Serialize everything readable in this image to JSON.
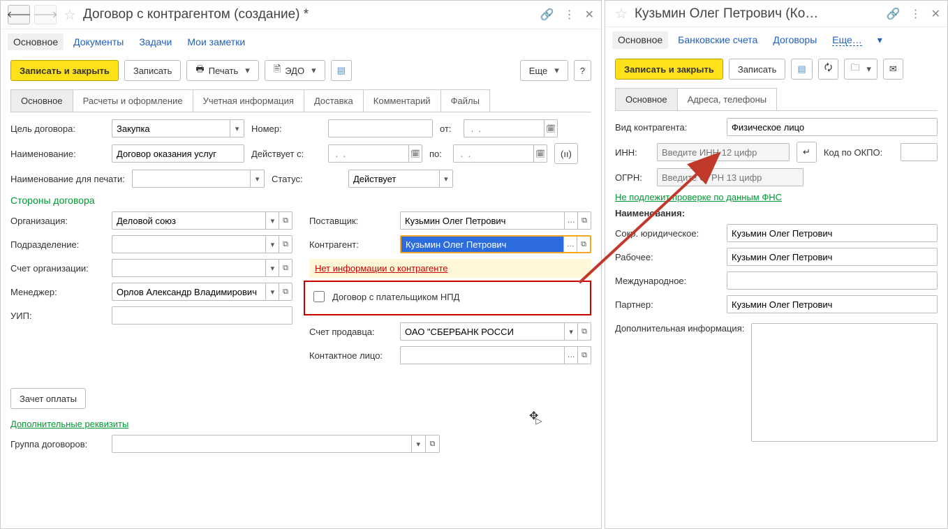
{
  "left": {
    "title": "Договор с контрагентом (создание) *",
    "nav": [
      "Основное",
      "Документы",
      "Задачи",
      "Мои заметки"
    ],
    "toolbar": {
      "save_close": "Записать и закрыть",
      "save": "Записать",
      "print": "Печать",
      "edo": "ЭДО",
      "more": "Еще"
    },
    "tabs": [
      "Основное",
      "Расчеты и оформление",
      "Учетная информация",
      "Доставка",
      "Комментарий",
      "Файлы"
    ],
    "labels": {
      "purpose": "Цель договора:",
      "number": "Номер:",
      "from": "от:",
      "name": "Наименование:",
      "valid_from": "Действует с:",
      "to": "по:",
      "print_name": "Наименование для печати:",
      "status": "Статус:",
      "parties": "Стороны договора",
      "org": "Организация:",
      "supplier": "Поставщик:",
      "dept": "Подразделение:",
      "counterparty": "Контрагент:",
      "org_acct": "Счет организации:",
      "manager": "Менеджер:",
      "seller_acct": "Счет продавца:",
      "uip": "УИП:",
      "contact": "Контактное лицо:",
      "offset": "Зачет оплаты",
      "add_req": "Дополнительные реквизиты",
      "group": "Группа договоров:",
      "no_info": "Нет информации о контрагенте",
      "npd_check": "Договор с плательщиком НПД"
    },
    "values": {
      "purpose": "Закупка",
      "name": "Договор оказания услуг",
      "status": "Действует",
      "org": "Деловой союз",
      "supplier": "Кузьмин Олег Петрович",
      "counterparty": "Кузьмин Олег Петрович",
      "manager": "Орлов Александр Владимирович",
      "seller_acct": "ОАО \"СБЕРБАНК РОССИ",
      "date_placeholder": " .  .    "
    }
  },
  "right": {
    "title": "Кузьмин Олег Петрович (Ко…",
    "nav": [
      "Основное",
      "Банковские счета",
      "Договоры"
    ],
    "nav_more": "Еще…",
    "toolbar": {
      "save_close": "Записать и закрыть",
      "save": "Записать"
    },
    "tabs": [
      "Основное",
      "Адреса, телефоны"
    ],
    "labels": {
      "kind": "Вид контрагента:",
      "inn": "ИНН:",
      "okpo": "Код по ОКПО:",
      "ogrn": "ОГРН:",
      "fns": "Не подлежит проверке по данным ФНС",
      "names": "Наименования:",
      "short": "Сокр. юридическое:",
      "work": "Рабочее:",
      "intl": "Международное:",
      "partner": "Партнер:",
      "add_info": "Дополнительная информация:"
    },
    "values": {
      "kind": "Физическое лицо",
      "short": "Кузьмин Олег Петрович",
      "work": "Кузьмин Олег Петрович",
      "partner": "Кузьмин Олег Петрович"
    },
    "placeholders": {
      "inn": "Введите ИНН 12 цифр",
      "ogrn": "Введите ОГРН 13 цифр"
    }
  }
}
